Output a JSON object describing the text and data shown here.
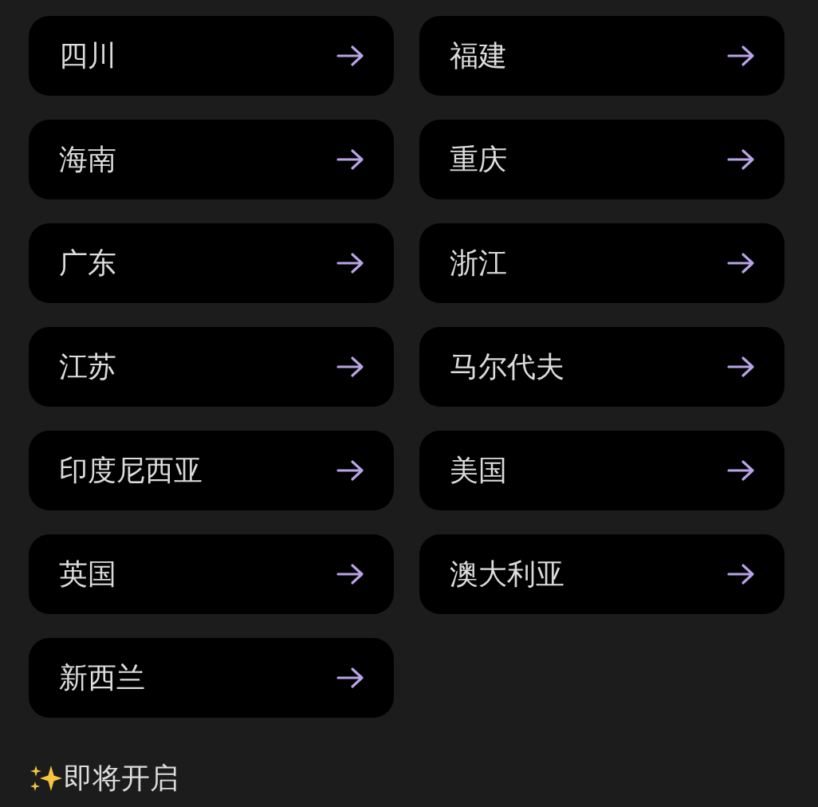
{
  "destinations": [
    {
      "label": "四川"
    },
    {
      "label": "福建"
    },
    {
      "label": "海南"
    },
    {
      "label": "重庆"
    },
    {
      "label": "广东"
    },
    {
      "label": "浙江"
    },
    {
      "label": "江苏"
    },
    {
      "label": "马尔代夫"
    },
    {
      "label": "印度尼西亚"
    },
    {
      "label": "美国"
    },
    {
      "label": "英国"
    },
    {
      "label": "澳大利亚"
    },
    {
      "label": "新西兰"
    }
  ],
  "footer": {
    "text": "即将开启"
  }
}
